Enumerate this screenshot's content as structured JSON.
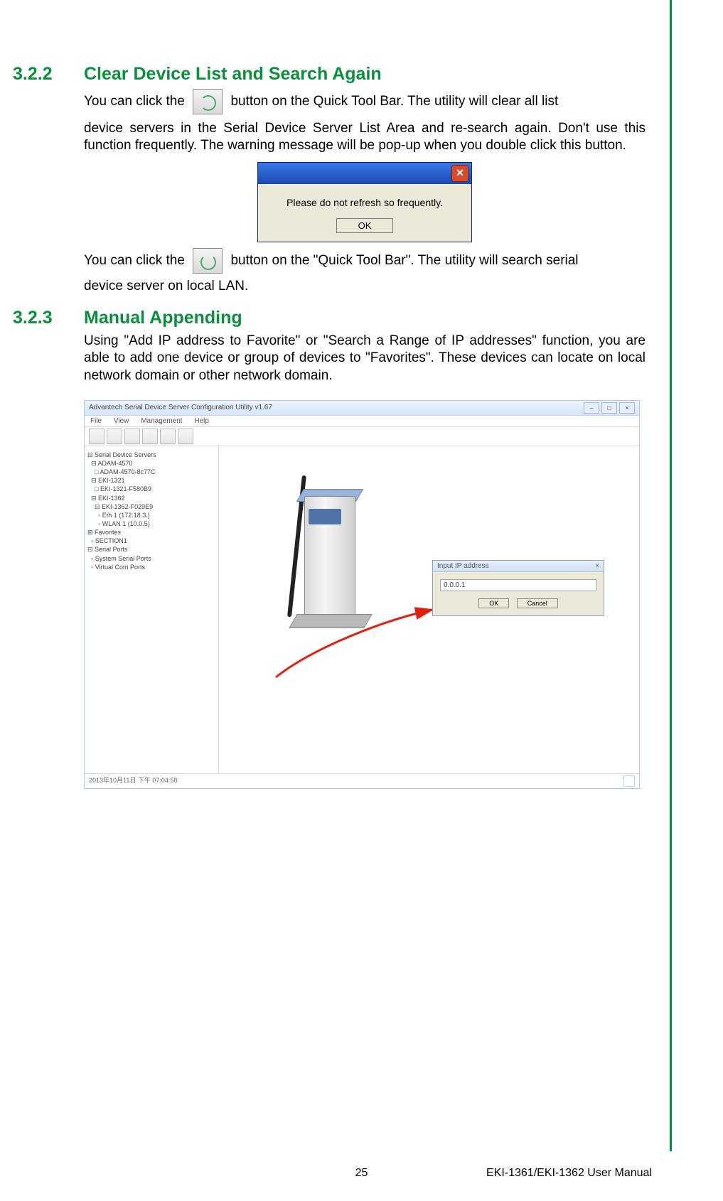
{
  "sections": {
    "s322": {
      "num": "3.2.2",
      "title": "Clear Device List and Search Again",
      "p1a": "You can click the ",
      "p1b": " button on the Quick Tool Bar. The utility will clear all list",
      "p2": "device servers in the Serial Device Server List Area and re-search again. Don't use this function frequently. The warning message will be pop-up when you double click this button.",
      "p3a": "You can click the ",
      "p3b": " button on the \"Quick Tool Bar\". The utility will search serial",
      "p4": "device server on local LAN."
    },
    "s323": {
      "num": "3.2.3",
      "title": "Manual Appending",
      "p1": "Using \"Add IP address to Favorite\" or \"Search a Range of IP addresses\" function, you are able to add one device or group of devices to \"Favorites\". These devices can locate on local network domain or other network domain."
    }
  },
  "warn_dialog": {
    "msg": "Please do not refresh so frequently.",
    "ok": "OK",
    "close_glyph": "✕"
  },
  "app": {
    "title": "Advantech Serial Device Server Configuration Utility v1.67",
    "menu": [
      "File",
      "View",
      "Management",
      "Help"
    ],
    "tree": [
      "⊟ Serial Device Servers",
      "  ⊟ ADAM-4570",
      "    □ ADAM-4570-8c77C",
      "  ⊟ EKI-1321",
      "    □ EKI-1321-F580B9",
      "  ⊟ EKI-1362",
      "    ⊟ EKI-1362-F029E9",
      "      ◦ Eth 1 (172.18.3.)",
      "      ◦ WLAN 1 (10.0.5)",
      "⊞ Favorites",
      "  ◦ SECTION1",
      "⊟ Serial Ports",
      "  ◦ System Serial Ports",
      "  ◦ Virtual Com Ports"
    ],
    "ip_dialog": {
      "title": "Input IP address",
      "value": "0.0.0.1",
      "ok": "OK",
      "cancel": "Cancel",
      "close_glyph": "×"
    },
    "status": "2013年10月11日 下午 07:04:58",
    "win_buttons": {
      "min": "–",
      "max": "□",
      "close": "×"
    }
  },
  "footer": {
    "page": "25",
    "doc": "EKI-1361/EKI-1362 User Manual"
  }
}
